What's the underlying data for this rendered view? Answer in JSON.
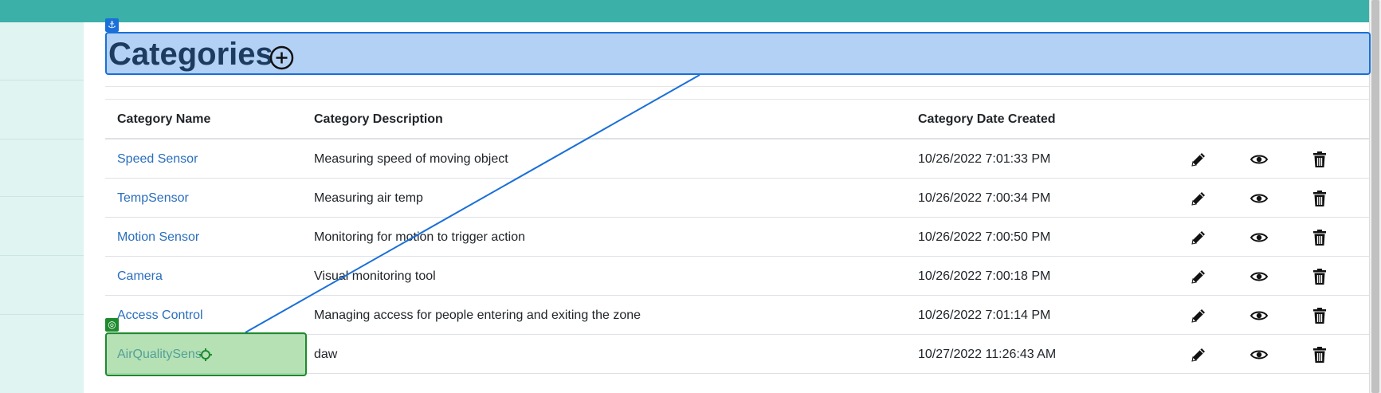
{
  "page": {
    "title": "Categories",
    "add_icon": "plus-circle-icon"
  },
  "table": {
    "headers": [
      "Category Name",
      "Category Description",
      "Category Date Created"
    ],
    "rows": [
      {
        "name": "Speed Sensor",
        "description": "Measuring speed of moving object",
        "date": "10/26/2022 7:01:33 PM"
      },
      {
        "name": "TempSensor",
        "description": "Measuring air temp",
        "date": "10/26/2022 7:00:34 PM"
      },
      {
        "name": "Motion Sensor",
        "description": "Monitoring for motion to trigger action",
        "date": "10/26/2022 7:00:50 PM"
      },
      {
        "name": "Camera",
        "description": "Visual monitoring tool",
        "date": "10/26/2022 7:00:18 PM"
      },
      {
        "name": "Access Control",
        "description": "Managing access for people entering and exiting the zone",
        "date": "10/26/2022 7:01:14 PM"
      },
      {
        "name": "AirQualitySens",
        "description": "daw",
        "date": "10/27/2022 11:26:43 AM"
      }
    ],
    "actions": [
      "pencil-icon",
      "eye-icon",
      "trash-icon"
    ]
  },
  "overlay": {
    "anchor_icon": "anchor-icon",
    "target_icon": "target-icon"
  },
  "colors": {
    "topbar": "#3ab0a8",
    "sidebar": "#e0f4f2",
    "link": "#2a6ebd",
    "title": "#1d3a5f",
    "overlay_blue": "#1a6fd8",
    "overlay_green": "#1e8a2e"
  }
}
